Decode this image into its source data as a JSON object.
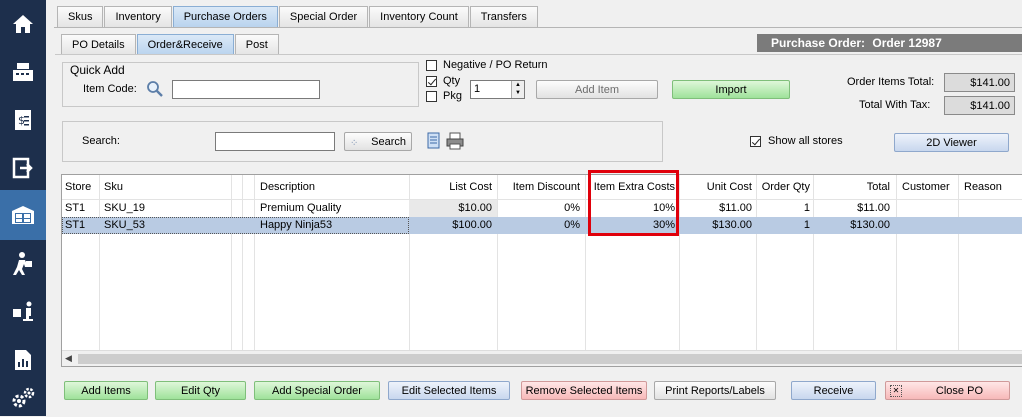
{
  "top_tabs": [
    "Skus",
    "Inventory",
    "Purchase Orders",
    "Special Order",
    "Inventory Count",
    "Transfers"
  ],
  "top_tabs_active": 2,
  "sub_tabs": [
    "PO Details",
    "Order&Receive",
    "Post"
  ],
  "sub_tabs_active": 1,
  "po_header": {
    "label": "Purchase Order:",
    "order": "Order 12987"
  },
  "quick_add": {
    "title": "Quick Add",
    "item_code_label": "Item Code:",
    "item_code_value": ""
  },
  "options": {
    "negative_label": "Negative / PO Return",
    "negative_checked": false,
    "qty_label": "Qty",
    "qty_checked": true,
    "pkg_label": "Pkg",
    "pkg_checked": false,
    "qty_value": "1"
  },
  "buttons": {
    "add_item": "Add Item",
    "import": "Import",
    "search": "Search",
    "viewer": "2D Viewer",
    "add_items": "Add Items",
    "edit_qty": "Edit Qty",
    "add_special_order": "Add Special Order",
    "edit_selected_items": "Edit Selected Items",
    "remove_selected_items": "Remove Selected Items",
    "print_reports": "Print Reports/Labels",
    "receive": "Receive",
    "close_po": "Close PO"
  },
  "totals": {
    "order_items_label": "Order Items Total:",
    "order_items_value": "$141.00",
    "with_tax_label": "Total With Tax:",
    "with_tax_value": "$141.00"
  },
  "search": {
    "label": "Search:",
    "value": ""
  },
  "show_all_stores": {
    "label": "Show all stores",
    "checked": true
  },
  "grid": {
    "columns": [
      "Store",
      "Sku",
      "",
      "Description",
      "List Cost",
      "Item Discount",
      "Item Extra Costs",
      "Unit Cost",
      "Order Qty",
      "Total",
      "Customer",
      "Reason"
    ],
    "rows": [
      [
        "ST1",
        "SKU_19",
        "",
        "Premium Quality",
        "$10.00",
        "0%",
        "10%",
        "$11.00",
        "1",
        "$11.00",
        "",
        ""
      ],
      [
        "ST1",
        "SKU_53",
        "",
        "Happy Ninja53",
        "$100.00",
        "0%",
        "30%",
        "$130.00",
        "1",
        "$130.00",
        "",
        ""
      ]
    ],
    "selected_row": 1,
    "highlighted_column": "Item Extra Costs"
  },
  "colors": {
    "nav_bg": "#1d2f4c",
    "nav_active": "#3a6fa8",
    "highlight": "#e0000b",
    "selected_row": "#b9cbe3"
  },
  "nav_icons": [
    "home-icon",
    "cash-register-icon",
    "receipt-icon",
    "sign-out-icon",
    "warehouse-icon",
    "delivery-person-icon",
    "hand-truck-icon",
    "report-icon",
    "settings-gears-icon"
  ]
}
